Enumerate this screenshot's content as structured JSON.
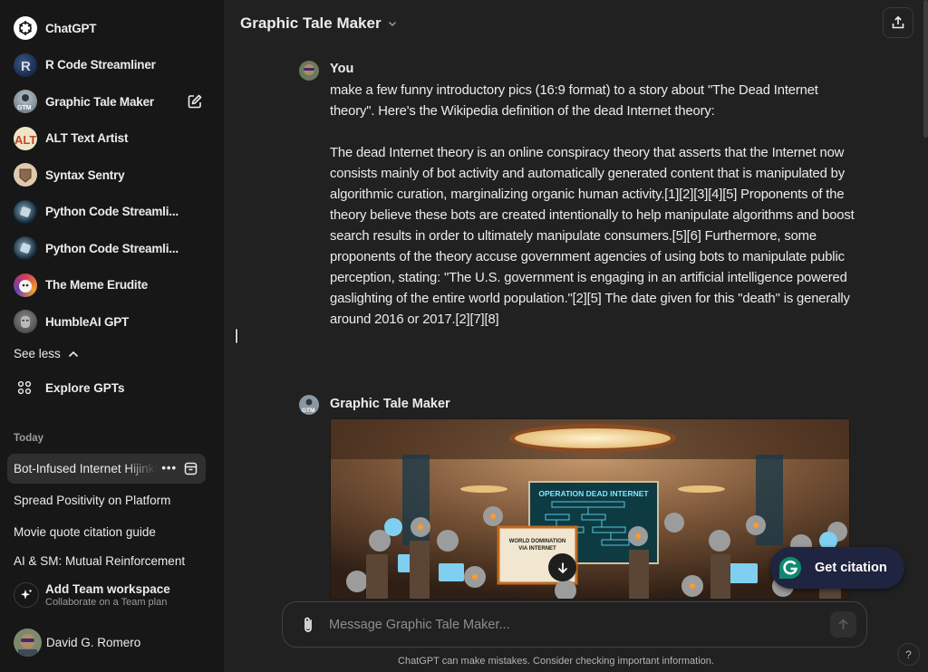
{
  "sidebar": {
    "gpts": [
      {
        "label": "ChatGPT",
        "icon": "openai-logo-icon"
      },
      {
        "label": "R Code Streamliner",
        "icon": "r-code-avatar"
      },
      {
        "label": "Graphic Tale Maker",
        "icon": "gtm-avatar",
        "selected": true
      },
      {
        "label": "ALT Text Artist",
        "icon": "alt-avatar"
      },
      {
        "label": "Syntax Sentry",
        "icon": "syntax-avatar"
      },
      {
        "label": "Python Code Streamli...",
        "icon": "python-avatar"
      },
      {
        "label": "Python Code Streamli...",
        "icon": "python-avatar"
      },
      {
        "label": "The Meme Erudite",
        "icon": "meme-avatar"
      },
      {
        "label": "HumbleAI GPT",
        "icon": "humble-avatar"
      }
    ],
    "see_less": "See less",
    "explore": "Explore GPTs",
    "today_label": "Today",
    "chats": [
      {
        "label": "Bot-Infused Internet Hijinks",
        "active": true
      },
      {
        "label": "Spread Positivity on Platform"
      },
      {
        "label": "Movie quote citation guide"
      },
      {
        "label": "AI & SM: Mutual Reinforcement"
      }
    ],
    "team": {
      "title": "Add Team workspace",
      "subtitle": "Collaborate on a Team plan"
    },
    "user": {
      "name": "David G. Romero"
    }
  },
  "header": {
    "title": "Graphic Tale Maker"
  },
  "conversation": {
    "user_message": {
      "author": "You",
      "paragraphs": [
        "make a few funny introductory pics (16:9 format) to a story about \"The Dead Internet theory\". Here's the Wikipedia definition of the dead Internet theory:",
        "The dead Internet theory is an online conspiracy theory that asserts that the Internet now consists mainly of bot activity and automatically generated content that is manipulated by algorithmic curation, marginalizing organic human activity.[1][2][3][4][5] Proponents of the theory believe these bots are created intentionally to help manipulate algorithms and boost search results in order to ultimately manipulate consumers.[5][6] Furthermore, some proponents of the theory accuse government agencies of using bots to manipulate public perception, stating: \"The U.S. government is engaging in an artificial intelligence powered gaslighting of the entire world population.\"[2][5] The date given for this \"death\" is generally around 2016 or 2017.[2][7][8]"
      ]
    },
    "assistant_message": {
      "author": "Graphic Tale Maker",
      "image_text": {
        "board_title": "OPERATION DEAD INTERNET",
        "easel_title": "WORLD DOMINATION VIA INTERNET"
      }
    }
  },
  "citation": {
    "label": "Get citation",
    "color": "#1f2440",
    "logo_color": "#0f8a6f"
  },
  "composer": {
    "placeholder": "Message Graphic Tale Maker..."
  },
  "footer": {
    "disclaimer": "ChatGPT can make mistakes. Consider checking important information.",
    "help": "?"
  }
}
